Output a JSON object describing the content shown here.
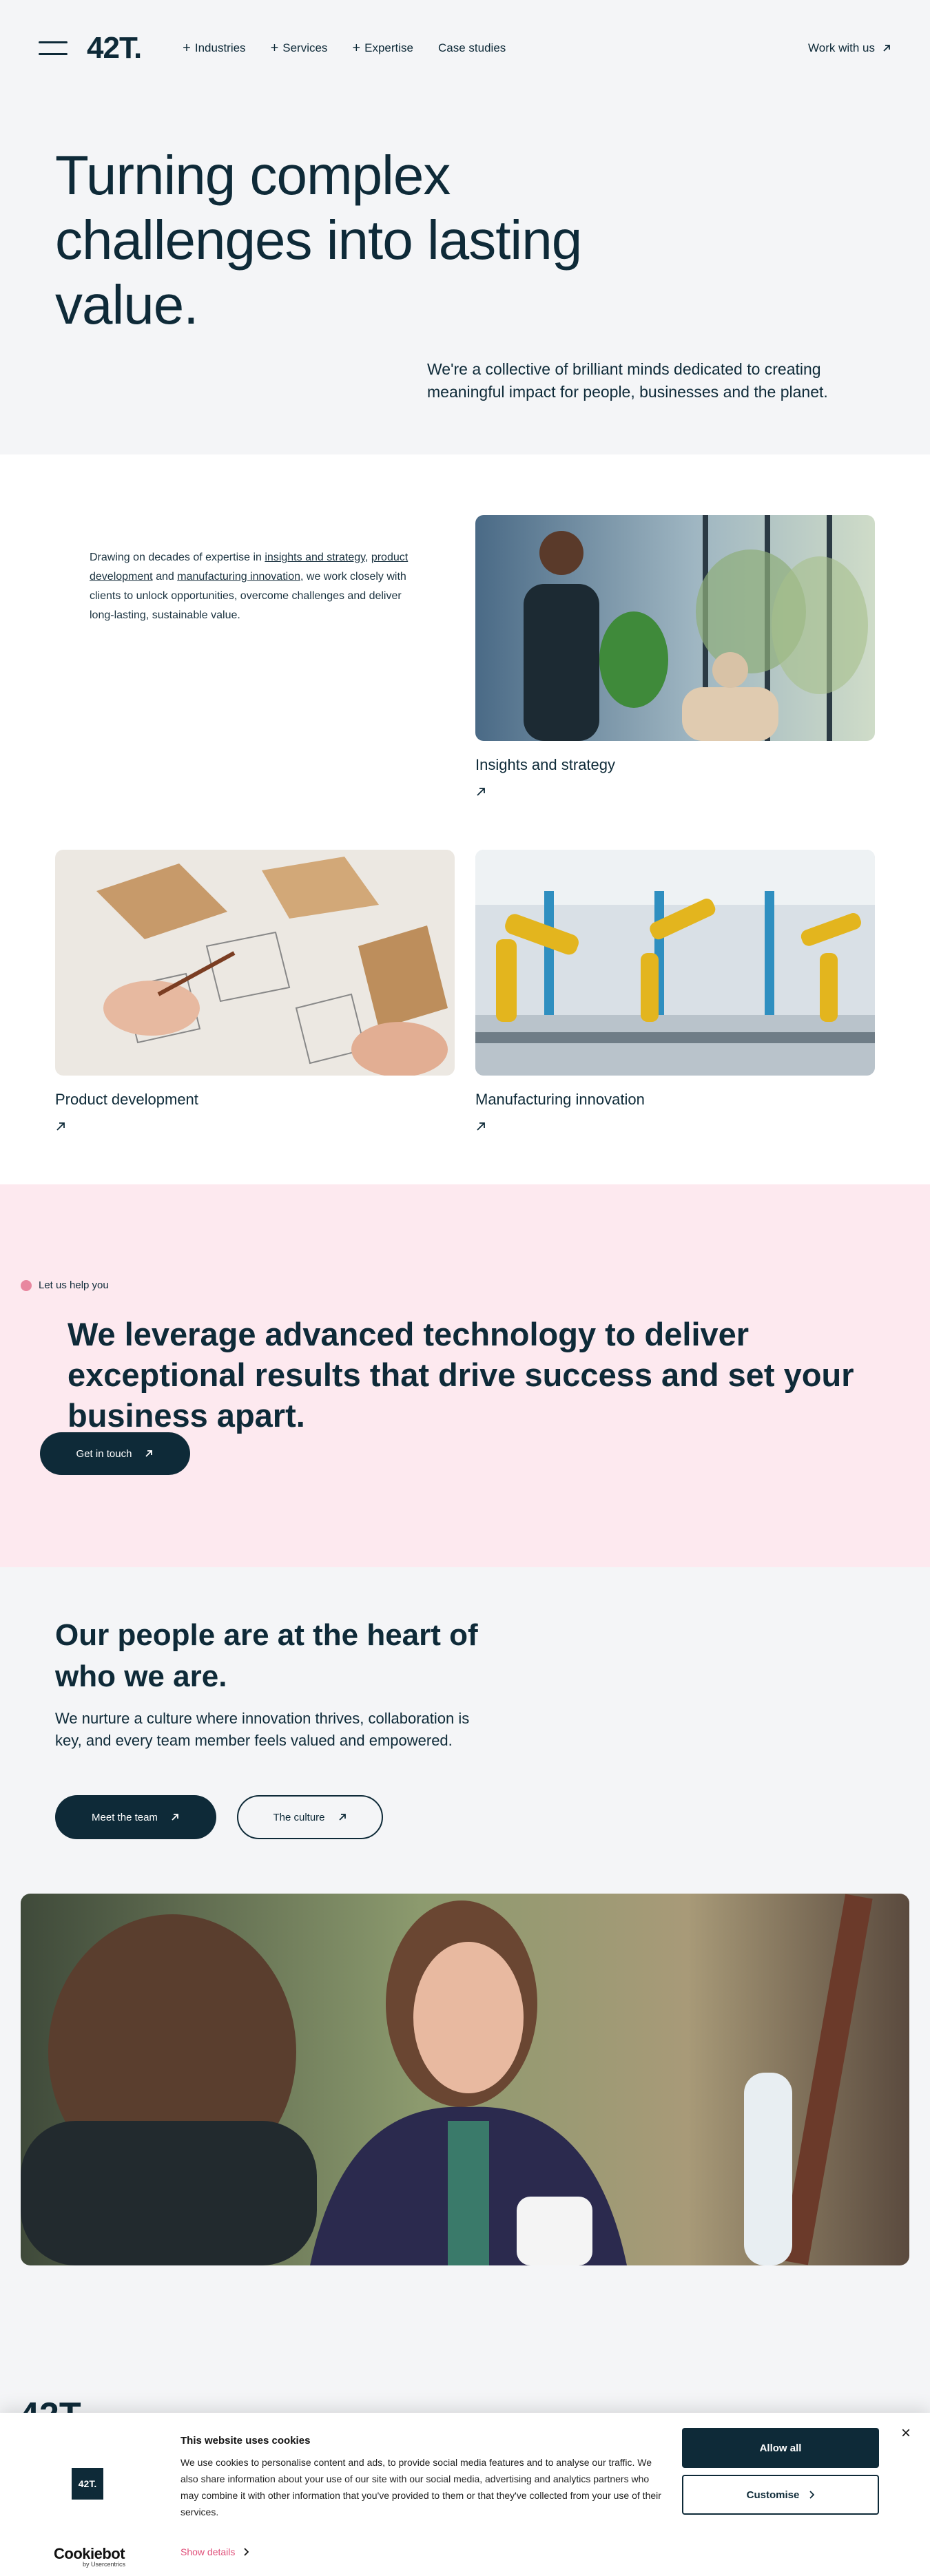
{
  "header": {
    "logo": "42T.",
    "nav": [
      {
        "label": "Industries",
        "has_plus": true
      },
      {
        "label": "Services",
        "has_plus": true
      },
      {
        "label": "Expertise",
        "has_plus": true
      },
      {
        "label": "Case studies",
        "has_plus": false
      }
    ],
    "cta": "Work with us"
  },
  "hero": {
    "title": "Turning complex challenges into lasting value.",
    "subtitle": "We're a collective of brilliant minds dedicated to creating meaningful impact for people, businesses and the planet."
  },
  "services": {
    "intro_parts": {
      "p1": "Drawing on decades of expertise in ",
      "link1": "insights and strategy",
      "p2": ", ",
      "link2": "product development",
      "p3": " and ",
      "link3": "manufacturing innovation",
      "p4": ", we work closely with clients to unlock opportunities, overcome challenges and deliver long-lasting, sustainable value."
    },
    "cards": [
      {
        "title": "Insights and strategy"
      },
      {
        "title": "Product development"
      },
      {
        "title": "Manufacturing innovation"
      }
    ]
  },
  "help": {
    "label": "Let us help you",
    "title": "We leverage advanced technology to deliver exceptional results that drive success and set your business apart.",
    "button": "Get in touch"
  },
  "people": {
    "title": "Our people are at the heart of who we are.",
    "subtitle": "We nurture a culture where innovation thrives, collaboration is key, and every team member feels valued and empowered.",
    "btn_team": "Meet the team",
    "btn_culture": "The culture"
  },
  "footer": {
    "logo": "42T."
  },
  "cookie": {
    "title": "This website uses cookies",
    "text": "We use cookies to personalise content and ads, to provide social media features and to analyse our traffic. We also share information about your use of our site with our social media, advertising and analytics partners who may combine it with other information that you've provided to them or that they've collected from your use of their services.",
    "brand_box": "42T.",
    "cookiebot": "Cookiebot",
    "cookiebot_sub": "by Usercentrics",
    "show_details": "Show details",
    "allow_all": "Allow all",
    "customise": "Customise",
    "close": "×"
  },
  "colors": {
    "navy": "#0e2a38",
    "pink_bg": "#fde9ef",
    "pink_dot": "#e8879f",
    "link_pink": "#e0507a"
  }
}
